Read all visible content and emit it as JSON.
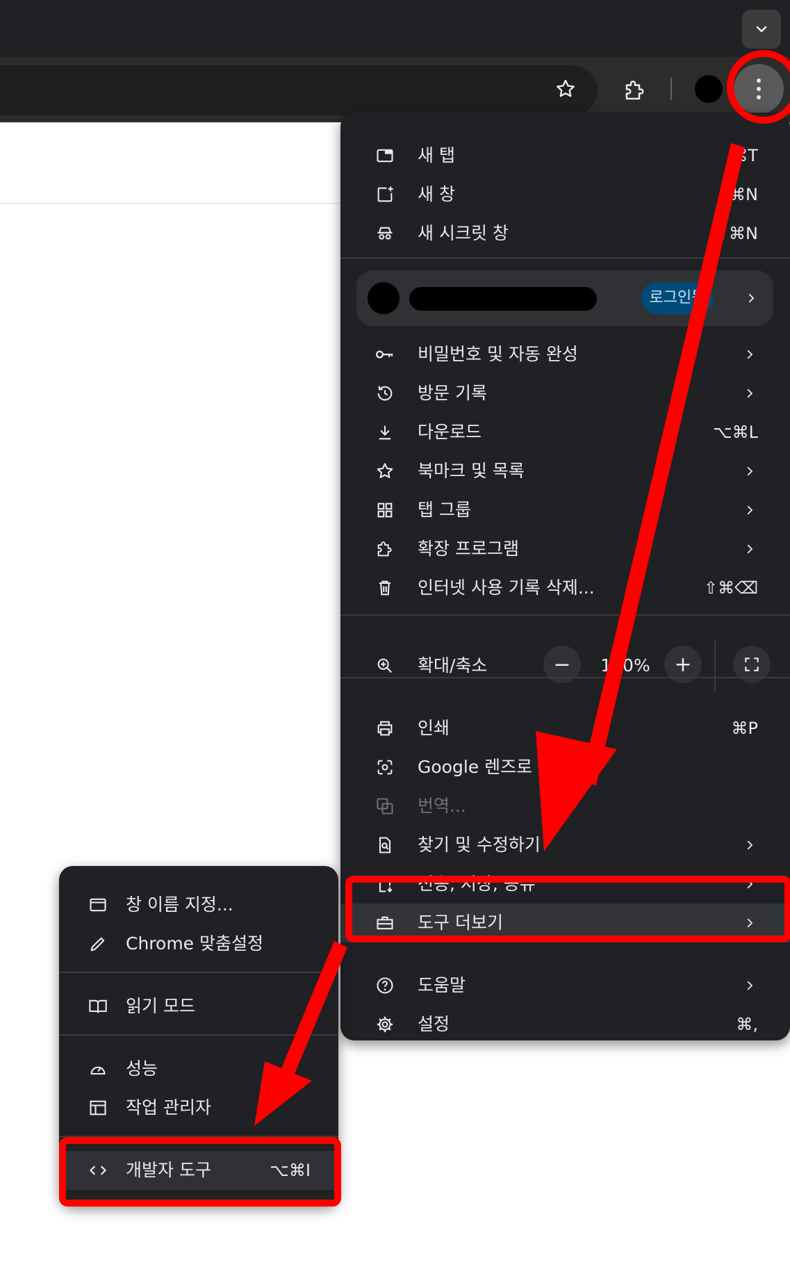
{
  "browser": {
    "tab_search_icon": "chevron-down-icon",
    "bookmark_icon": "star-icon",
    "extensions_icon": "puzzle-icon",
    "menu_icon": "vertical-dots-icon"
  },
  "main_menu": {
    "new_tab": {
      "label": "새 탭",
      "shortcut": "⌘T"
    },
    "new_window": {
      "label": "새 창",
      "shortcut": "⌘N"
    },
    "incognito": {
      "label": "새 시크릿 창",
      "shortcut": "⇧⌘N"
    },
    "profile": {
      "badge": "로그인됨"
    },
    "passwords": {
      "label": "비밀번호 및 자동 완성"
    },
    "history": {
      "label": "방문 기록"
    },
    "downloads": {
      "label": "다운로드",
      "shortcut": "⌥⌘L"
    },
    "bookmarks": {
      "label": "북마크 및 목록"
    },
    "tab_groups": {
      "label": "탭 그룹"
    },
    "extensions": {
      "label": "확장 프로그램"
    },
    "clear_data": {
      "label": "인터넷 사용 기록 삭제...",
      "shortcut": "⇧⌘⌫"
    },
    "zoom": {
      "label": "확대/축소",
      "value": "100%",
      "minus": "−",
      "plus": "+"
    },
    "print": {
      "label": "인쇄",
      "shortcut": "⌘P"
    },
    "lens": {
      "label": "Google 렌즈로"
    },
    "translate": {
      "label": "번역..."
    },
    "find": {
      "label": "찾기 및 수정하기"
    },
    "cast": {
      "label": "전송, 저장, 공유"
    },
    "more_tools": {
      "label": "도구 더보기"
    },
    "help": {
      "label": "도움말"
    },
    "settings": {
      "label": "설정",
      "shortcut": "⌘,"
    }
  },
  "sub_menu": {
    "name_window": {
      "label": "창 이름 지정..."
    },
    "customize": {
      "label": "Chrome 맞춤설정"
    },
    "reading_mode": {
      "label": "읽기 모드"
    },
    "performance": {
      "label": "성능"
    },
    "task_manager": {
      "label": "작업 관리자"
    },
    "dev_tools": {
      "label": "개발자 도구",
      "shortcut": "⌥⌘I"
    }
  },
  "colors": {
    "annotation": "#ff0000",
    "menu_bg": "#202124",
    "menu_text": "#e8eaed",
    "badge_bg": "#004a77"
  }
}
